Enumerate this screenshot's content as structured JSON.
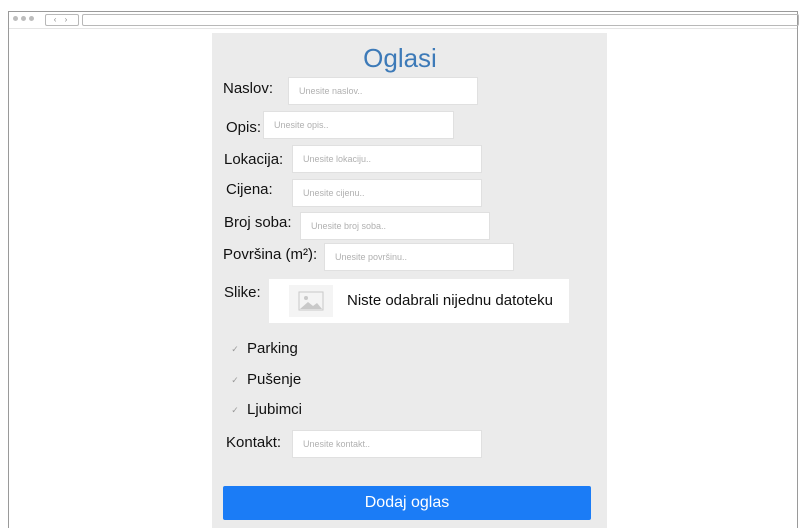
{
  "browser": {
    "nav_glyphs": "‹ ›"
  },
  "form": {
    "title": "Oglasi",
    "fields": {
      "naslov": {
        "label": "Naslov:",
        "placeholder": "Unesite naslov.."
      },
      "opis": {
        "label": "Opis:",
        "placeholder": "Unesite opis.."
      },
      "lokacija": {
        "label": "Lokacija:",
        "placeholder": "Unesite lokaciju.."
      },
      "cijena": {
        "label": "Cijena:",
        "placeholder": "Unesite cijenu.."
      },
      "broj_soba": {
        "label": "Broj soba:",
        "placeholder": "Unesite broj soba.."
      },
      "povrsina": {
        "label": "Površina (m²):",
        "placeholder": "Unesite površinu.."
      },
      "kontakt": {
        "label": "Kontakt:",
        "placeholder": "Unesite kontakt.."
      }
    },
    "slike": {
      "label": "Slike:",
      "file_status": "Niste odabrali nijednu datoteku"
    },
    "checkboxes": {
      "parking": {
        "label": "Parking",
        "glyph": "✓"
      },
      "pusenje": {
        "label": "Pušenje",
        "glyph": "✓"
      },
      "ljubimci": {
        "label": "Ljubimci",
        "glyph": "✓"
      }
    },
    "submit_label": "Dodaj oglas",
    "accent_color": "#1b7cf6",
    "title_color": "#3d7ab8"
  }
}
